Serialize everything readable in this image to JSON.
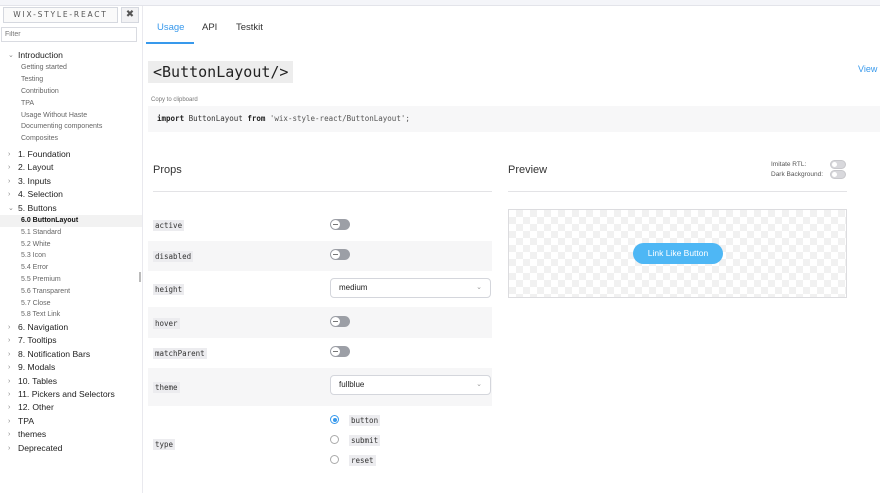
{
  "sidebar": {
    "brand": "WIX-STYLE-REACT",
    "clear_icon": "close-icon",
    "filter_placeholder": "Filter",
    "intro": {
      "label": "Introduction",
      "items": [
        "Getting started",
        "Testing",
        "Contribution",
        "TPA",
        "Usage Without Haste",
        "Documenting components",
        "Composites"
      ]
    },
    "groups_before": [
      "1. Foundation",
      "2. Layout",
      "3. Inputs",
      "4. Selection"
    ],
    "buttons": {
      "label": "5. Buttons",
      "items": [
        "6.0 ButtonLayout",
        "5.1 Standard",
        "5.2 White",
        "5.3 Icon",
        "5.4 Error",
        "5.5 Premium",
        "5.6 Transparent",
        "5.7 Close",
        "5.8 Text Link"
      ],
      "active": "6.0 ButtonLayout"
    },
    "groups_after": [
      "6. Navigation",
      "7. Tooltips",
      "8. Notification Bars",
      "9. Modals",
      "10. Tables",
      "11. Pickers and Selectors",
      "12. Other",
      "TPA",
      "themes",
      "Deprecated"
    ]
  },
  "tabs": [
    {
      "label": "Usage",
      "active": true
    },
    {
      "label": "API",
      "active": false
    },
    {
      "label": "Testkit",
      "active": false
    }
  ],
  "title": "<ButtonLayout/>",
  "view_source": "View s",
  "copy_label": "Copy to clipboard",
  "code": {
    "kw_import": "import",
    "ident": " ButtonLayout ",
    "kw_from": "from",
    "path": " 'wix-style-react/ButtonLayout';"
  },
  "props_title": "Props",
  "preview_title": "Preview",
  "imitate_rtl": "Imitate RTL:",
  "dark_background": "Dark Background:",
  "props": {
    "active": {
      "name": "active",
      "value": false
    },
    "disabled": {
      "name": "disabled",
      "value": false
    },
    "height": {
      "name": "height",
      "value": "medium"
    },
    "hover": {
      "name": "hover",
      "value": false
    },
    "matchParent": {
      "name": "matchParent",
      "value": false
    },
    "theme": {
      "name": "theme",
      "value": "fullblue"
    },
    "type": {
      "name": "type",
      "options": [
        "button",
        "submit",
        "reset"
      ],
      "selected": "button"
    }
  },
  "preview_button": "Link Like Button",
  "colors": {
    "accent": "#3899ec",
    "preview_button": "#4eb7f5"
  }
}
